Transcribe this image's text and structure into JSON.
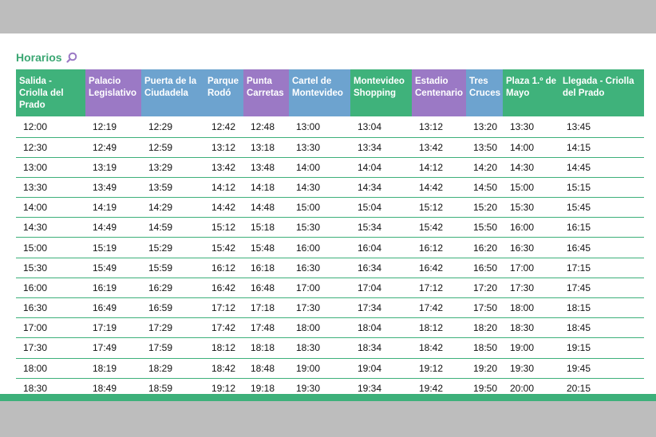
{
  "title": "Horarios",
  "colors": {
    "green": "#3fb27b",
    "purple": "#9b79c5",
    "blue": "#6da3cf",
    "rule": "#3db07a"
  },
  "header": [
    {
      "label": "Salida - Criolla del Prado",
      "color": "green"
    },
    {
      "label": "Palacio Legislativo",
      "color": "purple"
    },
    {
      "label": "Puerta de la Ciudadela",
      "color": "blue"
    },
    {
      "label": "Parque Rodó",
      "color": "blue"
    },
    {
      "label": "Punta Carretas",
      "color": "purple"
    },
    {
      "label": "Cartel de Montevideo",
      "color": "blue"
    },
    {
      "label": "Montevideo Shopping",
      "color": "green"
    },
    {
      "label": "Estadio Centenario",
      "color": "purple"
    },
    {
      "label": "Tres Cruces",
      "color": "blue"
    },
    {
      "label": "Plaza 1.º de Mayo",
      "color": "green"
    },
    {
      "label": "Llegada - Criolla del Prado",
      "color": "green"
    }
  ],
  "rows": [
    [
      "12:00",
      "12:19",
      "12:29",
      "12:42",
      "12:48",
      "13:00",
      "13:04",
      "13:12",
      "13:20",
      "13:30",
      "13:45"
    ],
    [
      "12:30",
      "12:49",
      "12:59",
      "13:12",
      "13:18",
      "13:30",
      "13:34",
      "13:42",
      "13:50",
      "14:00",
      "14:15"
    ],
    [
      "13:00",
      "13:19",
      "13:29",
      "13:42",
      "13:48",
      "14:00",
      "14:04",
      "14:12",
      "14:20",
      "14:30",
      "14:45"
    ],
    [
      "13:30",
      "13:49",
      "13:59",
      "14:12",
      "14:18",
      "14:30",
      "14:34",
      "14:42",
      "14:50",
      "15:00",
      "15:15"
    ],
    [
      "14:00",
      "14:19",
      "14:29",
      "14:42",
      "14:48",
      "15:00",
      "15:04",
      "15:12",
      "15:20",
      "15:30",
      "15:45"
    ],
    [
      "14:30",
      "14:49",
      "14:59",
      "15:12",
      "15:18",
      "15:30",
      "15:34",
      "15:42",
      "15:50",
      "16:00",
      "16:15"
    ],
    [
      "15:00",
      "15:19",
      "15:29",
      "15:42",
      "15:48",
      "16:00",
      "16:04",
      "16:12",
      "16:20",
      "16:30",
      "16:45"
    ],
    [
      "15:30",
      "15:49",
      "15:59",
      "16:12",
      "16:18",
      "16:30",
      "16:34",
      "16:42",
      "16:50",
      "17:00",
      "17:15"
    ],
    [
      "16:00",
      "16:19",
      "16:29",
      "16:42",
      "16:48",
      "17:00",
      "17:04",
      "17:12",
      "17:20",
      "17:30",
      "17:45"
    ],
    [
      "16:30",
      "16:49",
      "16:59",
      "17:12",
      "17:18",
      "17:30",
      "17:34",
      "17:42",
      "17:50",
      "18:00",
      "18:15"
    ],
    [
      "17:00",
      "17:19",
      "17:29",
      "17:42",
      "17:48",
      "18:00",
      "18:04",
      "18:12",
      "18:20",
      "18:30",
      "18:45"
    ],
    [
      "17:30",
      "17:49",
      "17:59",
      "18:12",
      "18:18",
      "18:30",
      "18:34",
      "18:42",
      "18:50",
      "19:00",
      "19:15"
    ],
    [
      "18:00",
      "18:19",
      "18:29",
      "18:42",
      "18:48",
      "19:00",
      "19:04",
      "19:12",
      "19:20",
      "19:30",
      "19:45"
    ],
    [
      "18:30",
      "18:49",
      "18:59",
      "19:12",
      "19:18",
      "19:30",
      "19:34",
      "19:42",
      "19:50",
      "20:00",
      "20:15"
    ]
  ]
}
